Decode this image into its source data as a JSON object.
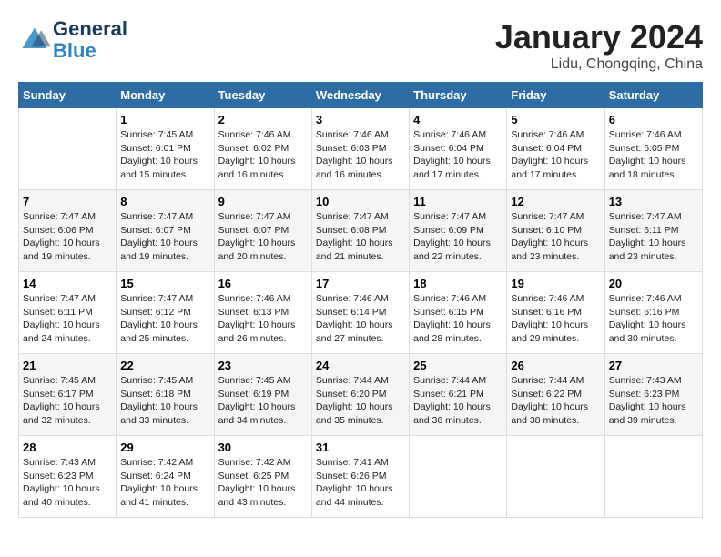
{
  "logo": {
    "general": "General",
    "blue": "Blue"
  },
  "title": "January 2024",
  "subtitle": "Lidu, Chongqing, China",
  "days_header": [
    "Sunday",
    "Monday",
    "Tuesday",
    "Wednesday",
    "Thursday",
    "Friday",
    "Saturday"
  ],
  "weeks": [
    [
      {
        "day": "",
        "content": ""
      },
      {
        "day": "1",
        "content": "Sunrise: 7:45 AM\nSunset: 6:01 PM\nDaylight: 10 hours\nand 15 minutes."
      },
      {
        "day": "2",
        "content": "Sunrise: 7:46 AM\nSunset: 6:02 PM\nDaylight: 10 hours\nand 16 minutes."
      },
      {
        "day": "3",
        "content": "Sunrise: 7:46 AM\nSunset: 6:03 PM\nDaylight: 10 hours\nand 16 minutes."
      },
      {
        "day": "4",
        "content": "Sunrise: 7:46 AM\nSunset: 6:04 PM\nDaylight: 10 hours\nand 17 minutes."
      },
      {
        "day": "5",
        "content": "Sunrise: 7:46 AM\nSunset: 6:04 PM\nDaylight: 10 hours\nand 17 minutes."
      },
      {
        "day": "6",
        "content": "Sunrise: 7:46 AM\nSunset: 6:05 PM\nDaylight: 10 hours\nand 18 minutes."
      }
    ],
    [
      {
        "day": "7",
        "content": "Sunrise: 7:47 AM\nSunset: 6:06 PM\nDaylight: 10 hours\nand 19 minutes."
      },
      {
        "day": "8",
        "content": "Sunrise: 7:47 AM\nSunset: 6:07 PM\nDaylight: 10 hours\nand 19 minutes."
      },
      {
        "day": "9",
        "content": "Sunrise: 7:47 AM\nSunset: 6:07 PM\nDaylight: 10 hours\nand 20 minutes."
      },
      {
        "day": "10",
        "content": "Sunrise: 7:47 AM\nSunset: 6:08 PM\nDaylight: 10 hours\nand 21 minutes."
      },
      {
        "day": "11",
        "content": "Sunrise: 7:47 AM\nSunset: 6:09 PM\nDaylight: 10 hours\nand 22 minutes."
      },
      {
        "day": "12",
        "content": "Sunrise: 7:47 AM\nSunset: 6:10 PM\nDaylight: 10 hours\nand 23 minutes."
      },
      {
        "day": "13",
        "content": "Sunrise: 7:47 AM\nSunset: 6:11 PM\nDaylight: 10 hours\nand 23 minutes."
      }
    ],
    [
      {
        "day": "14",
        "content": "Sunrise: 7:47 AM\nSunset: 6:11 PM\nDaylight: 10 hours\nand 24 minutes."
      },
      {
        "day": "15",
        "content": "Sunrise: 7:47 AM\nSunset: 6:12 PM\nDaylight: 10 hours\nand 25 minutes."
      },
      {
        "day": "16",
        "content": "Sunrise: 7:46 AM\nSunset: 6:13 PM\nDaylight: 10 hours\nand 26 minutes."
      },
      {
        "day": "17",
        "content": "Sunrise: 7:46 AM\nSunset: 6:14 PM\nDaylight: 10 hours\nand 27 minutes."
      },
      {
        "day": "18",
        "content": "Sunrise: 7:46 AM\nSunset: 6:15 PM\nDaylight: 10 hours\nand 28 minutes."
      },
      {
        "day": "19",
        "content": "Sunrise: 7:46 AM\nSunset: 6:16 PM\nDaylight: 10 hours\nand 29 minutes."
      },
      {
        "day": "20",
        "content": "Sunrise: 7:46 AM\nSunset: 6:16 PM\nDaylight: 10 hours\nand 30 minutes."
      }
    ],
    [
      {
        "day": "21",
        "content": "Sunrise: 7:45 AM\nSunset: 6:17 PM\nDaylight: 10 hours\nand 32 minutes."
      },
      {
        "day": "22",
        "content": "Sunrise: 7:45 AM\nSunset: 6:18 PM\nDaylight: 10 hours\nand 33 minutes."
      },
      {
        "day": "23",
        "content": "Sunrise: 7:45 AM\nSunset: 6:19 PM\nDaylight: 10 hours\nand 34 minutes."
      },
      {
        "day": "24",
        "content": "Sunrise: 7:44 AM\nSunset: 6:20 PM\nDaylight: 10 hours\nand 35 minutes."
      },
      {
        "day": "25",
        "content": "Sunrise: 7:44 AM\nSunset: 6:21 PM\nDaylight: 10 hours\nand 36 minutes."
      },
      {
        "day": "26",
        "content": "Sunrise: 7:44 AM\nSunset: 6:22 PM\nDaylight: 10 hours\nand 38 minutes."
      },
      {
        "day": "27",
        "content": "Sunrise: 7:43 AM\nSunset: 6:23 PM\nDaylight: 10 hours\nand 39 minutes."
      }
    ],
    [
      {
        "day": "28",
        "content": "Sunrise: 7:43 AM\nSunset: 6:23 PM\nDaylight: 10 hours\nand 40 minutes."
      },
      {
        "day": "29",
        "content": "Sunrise: 7:42 AM\nSunset: 6:24 PM\nDaylight: 10 hours\nand 41 minutes."
      },
      {
        "day": "30",
        "content": "Sunrise: 7:42 AM\nSunset: 6:25 PM\nDaylight: 10 hours\nand 43 minutes."
      },
      {
        "day": "31",
        "content": "Sunrise: 7:41 AM\nSunset: 6:26 PM\nDaylight: 10 hours\nand 44 minutes."
      },
      {
        "day": "",
        "content": ""
      },
      {
        "day": "",
        "content": ""
      },
      {
        "day": "",
        "content": ""
      }
    ]
  ]
}
